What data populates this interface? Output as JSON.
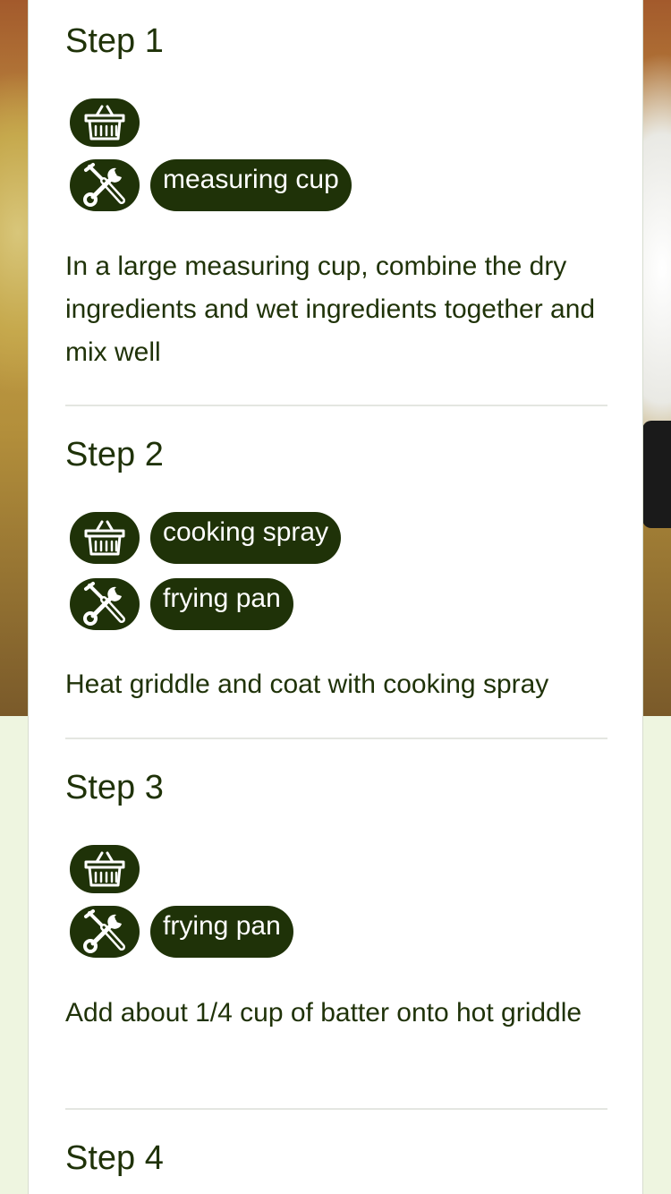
{
  "steps": [
    {
      "title": "Step 1",
      "ingredients": [],
      "tools": [
        "measuring cup"
      ],
      "description": "In a large measuring cup, combine the dry ingredients and wet ingredients together and mix well"
    },
    {
      "title": "Step 2",
      "ingredients": [
        "cooking spray"
      ],
      "tools": [
        "frying pan"
      ],
      "description": "Heat griddle and coat with cooking spray"
    },
    {
      "title": "Step 3",
      "ingredients": [],
      "tools": [
        "frying pan"
      ],
      "description": "Add about 1/4 cup of batter onto hot griddle"
    },
    {
      "title": "Step 4"
    }
  ],
  "icons": {
    "ingredients": "basket-icon",
    "tools": "tools-icon"
  },
  "colors": {
    "accent": "#1f3208",
    "page_background": "#eef5e0",
    "card_background": "#ffffff"
  }
}
